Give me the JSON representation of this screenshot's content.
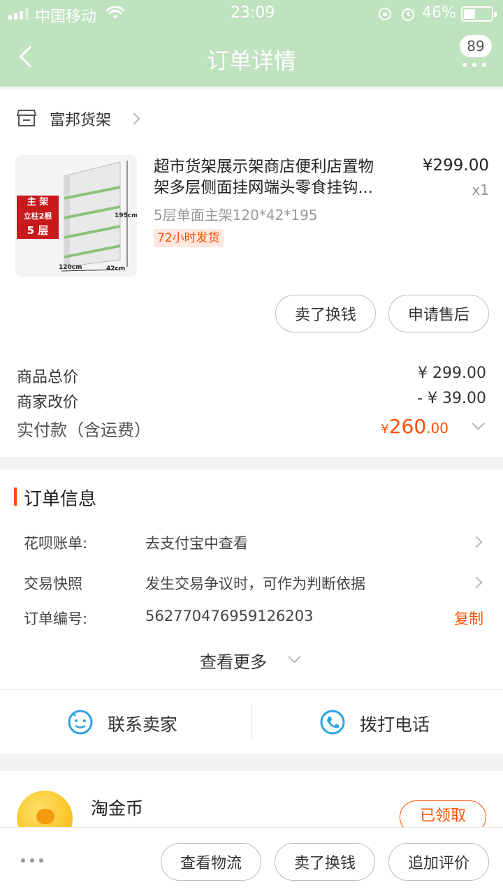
{
  "status_bar": {
    "carrier": "中国移动",
    "time": "23:09",
    "battery": "46%"
  },
  "nav": {
    "title": "订单详情",
    "badge": "89"
  },
  "shop": {
    "name": "富邦货架"
  },
  "product": {
    "title_line1": "超市货架展示架商店便利店置物",
    "title_line2": "架多层侧面挂网端头零食挂钩...",
    "price": "¥299.00",
    "qty": "x1",
    "spec": "5层单面主架120*42*195",
    "tag": "72小时发货",
    "image_text": {
      "top": "主 架",
      "mid": "立柱2根",
      "bottom": "5 层",
      "height": "195cm",
      "width": "120cm",
      "depth": "42cm"
    }
  },
  "item_actions": {
    "sell": "卖了换钱",
    "after_sale": "申请售后"
  },
  "price_summary": {
    "total_label": "商品总价",
    "total_value": "¥ 299.00",
    "adjust_label": "商家改价",
    "adjust_value": "- ¥ 39.00",
    "paid_label": "实付款（含运费）",
    "paid_currency": "¥",
    "paid_int": "260",
    "paid_dec": ".00"
  },
  "order_info": {
    "heading": "订单信息",
    "rows": [
      {
        "label": "花呗账单:",
        "value": "去支付宝中查看"
      },
      {
        "label": "交易快照",
        "value": "发生交易争议时，可作为判断依据"
      },
      {
        "label": "订单编号:",
        "value": "562770476959126203",
        "action": "复制"
      }
    ],
    "more": "查看更多"
  },
  "contact": {
    "seller": "联系卖家",
    "phone": "拨打电话"
  },
  "coin": {
    "title": "淘金币",
    "button": "已领取"
  },
  "bottom_bar": {
    "logistics": "查看物流",
    "sell": "卖了换钱",
    "review": "追加评价"
  },
  "colors": {
    "header": "#bfe2bf",
    "accent": "#ff5000",
    "tag_bg": "#fde7df",
    "icon_blue": "#2aa4e0"
  }
}
